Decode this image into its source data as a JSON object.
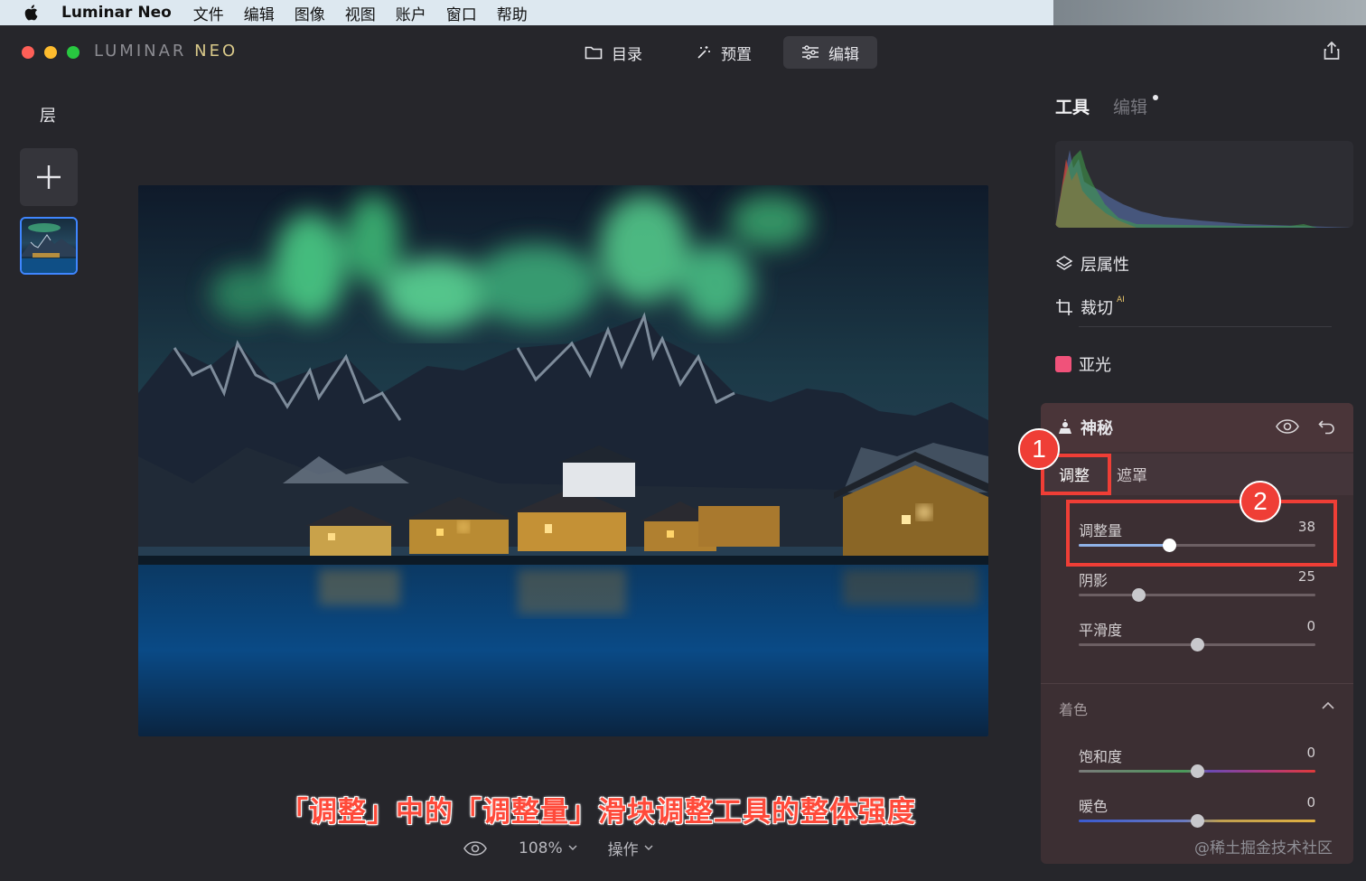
{
  "menubar": {
    "app_name": "Luminar Neo",
    "items": [
      "文件",
      "编辑",
      "图像",
      "视图",
      "账户",
      "窗口",
      "帮助"
    ]
  },
  "window": {
    "logo_main": "LUMINAR",
    "logo_accent": "NEO",
    "nav": [
      {
        "label": "目录",
        "icon": "folder-icon"
      },
      {
        "label": "预置",
        "icon": "magic-wand-icon"
      },
      {
        "label": "编辑",
        "icon": "sliders-icon",
        "active": true
      }
    ]
  },
  "layers": {
    "title": "层"
  },
  "right_panel": {
    "tabs": {
      "tools": "工具",
      "edits": "编辑"
    },
    "items": {
      "layer_props": "层属性",
      "crop": "裁切",
      "crop_badge": "AI",
      "matte": "亚光"
    },
    "matte_color": "#f0527a"
  },
  "tool": {
    "name": "神秘",
    "subtabs": {
      "adjust": "调整",
      "mask": "遮罩"
    },
    "sliders": [
      {
        "label": "调整量",
        "value": "38",
        "pos": 0.38
      },
      {
        "label": "阴影",
        "value": "25",
        "pos": 0.25
      },
      {
        "label": "平滑度",
        "value": "0",
        "pos": 0.5
      }
    ],
    "color_section": "着色",
    "color_sliders": [
      {
        "label": "饱和度",
        "value": "0",
        "pos": 0.5
      },
      {
        "label": "暖色",
        "value": "0",
        "pos": 0.5
      }
    ]
  },
  "annotations": {
    "badge1": "1",
    "badge2": "2",
    "caption": "「调整」中的「调整量」滑块调整工具的整体强度",
    "accent_color": "#ef3e36"
  },
  "bottom": {
    "zoom": "108%",
    "actions": "操作"
  },
  "watermark": "@稀土掘金技术社区"
}
